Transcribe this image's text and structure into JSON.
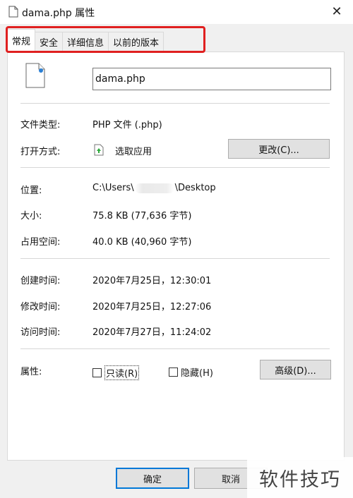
{
  "window": {
    "title": "dama.php 属性",
    "close_glyph": "✕"
  },
  "tabs": [
    {
      "label": "常规",
      "active": true
    },
    {
      "label": "安全",
      "active": false
    },
    {
      "label": "详细信息",
      "active": false
    },
    {
      "label": "以前的版本",
      "active": false
    }
  ],
  "file": {
    "name": "dama.php"
  },
  "fields": {
    "type_label": "文件类型:",
    "type_value": "PHP 文件 (.php)",
    "open_label": "打开方式:",
    "open_value": "选取应用",
    "change_button": "更改(C)...",
    "location_label": "位置:",
    "location_prefix": "C:\\Users\\",
    "location_suffix": "\\Desktop",
    "size_label": "大小:",
    "size_value": "75.8 KB (77,636 字节)",
    "disk_label": "占用空间:",
    "disk_value": "40.0 KB (40,960 字节)",
    "created_label": "创建时间:",
    "created_value": "2020年7月25日，12:30:01",
    "modified_label": "修改时间:",
    "modified_value": "2020年7月25日，12:27:06",
    "accessed_label": "访问时间:",
    "accessed_value": "2020年7月27日，11:24:02",
    "attr_label": "属性:",
    "readonly_label": "只读(R)",
    "hidden_label": "隐藏(H)",
    "advanced_button": "高级(D)..."
  },
  "buttons": {
    "ok": "确定",
    "cancel": "取消"
  },
  "watermark": "软件技巧",
  "colors": {
    "highlight": "#e02020",
    "focus_blue": "#0078d7"
  }
}
